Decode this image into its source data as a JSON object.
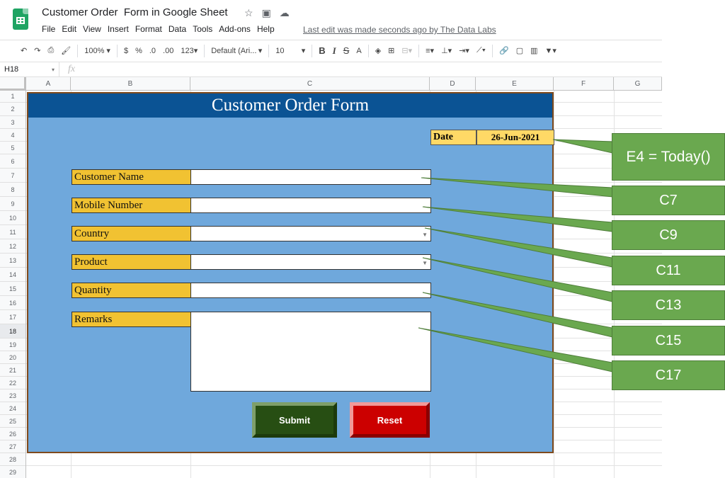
{
  "app": {
    "doc_title": "Customer Order  Form in Google Sheet",
    "menu": [
      "File",
      "Edit",
      "View",
      "Insert",
      "Format",
      "Data",
      "Tools",
      "Add-ons",
      "Help"
    ],
    "last_edit": "Last edit was made seconds ago by The Data Labs",
    "brand_color": "#1fa463"
  },
  "toolbar": {
    "zoom": "100%",
    "currency": "$",
    "percent": "%",
    "decimal_decrease": ".0",
    "decimal_increase": ".00",
    "number_format": "123",
    "font": "Default (Ari...",
    "font_size": "10",
    "bold": "B",
    "italic": "I",
    "strike": "S",
    "text_color": "A"
  },
  "formula_bar": {
    "cell_ref": "H18",
    "fx": "fx",
    "content": ""
  },
  "grid": {
    "columns": [
      "A",
      "B",
      "C",
      "D",
      "E",
      "F",
      "G"
    ],
    "rows": [
      "1",
      "2",
      "3",
      "4",
      "5",
      "6",
      "7",
      "8",
      "9",
      "10",
      "11",
      "12",
      "13",
      "14",
      "15",
      "16",
      "17",
      "18",
      "19",
      "20",
      "21",
      "22",
      "23",
      "24",
      "25",
      "26",
      "27",
      "28",
      "29"
    ],
    "selected_row": "18"
  },
  "form": {
    "title": "Customer Order Form",
    "date_label": "Date",
    "date_value": "26-Jun-2021",
    "fields": {
      "customer_name": "Customer Name",
      "mobile_number": "Mobile Number",
      "country": "Country",
      "product": "Product",
      "quantity": "Quantity",
      "remarks": "Remarks"
    },
    "submit_label": "Submit",
    "reset_label": "Reset",
    "colors": {
      "header": "#0b5394",
      "background": "#6fa8dc",
      "label": "#f1c232",
      "date": "#ffd966",
      "submit": "#274e13",
      "reset": "#cc0000"
    }
  },
  "callouts": {
    "date_formula": "E4 = Today()",
    "c7": "C7",
    "c9": "C9",
    "c11": "C11",
    "c13": "C13",
    "c15": "C15",
    "c17": "C17",
    "color": "#6aa84f"
  }
}
